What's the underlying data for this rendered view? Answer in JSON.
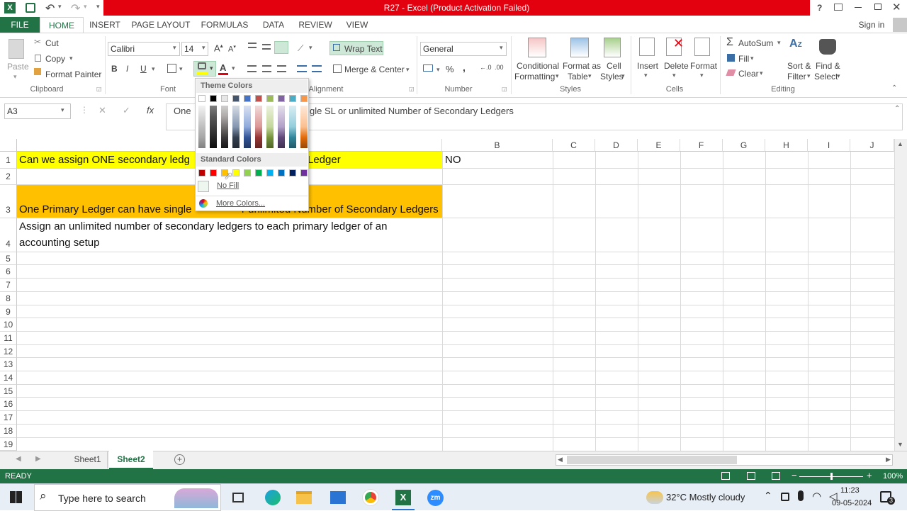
{
  "window": {
    "title": "R27 -  Excel (Product Activation Failed)",
    "help": "?",
    "sign_in": "Sign in"
  },
  "tabs": [
    "FILE",
    "HOME",
    "INSERT",
    "PAGE LAYOUT",
    "FORMULAS",
    "DATA",
    "REVIEW",
    "VIEW"
  ],
  "ribbon": {
    "clipboard": {
      "paste": "Paste",
      "cut": "Cut",
      "copy": "Copy",
      "format_painter": "Format Painter",
      "label": "Clipboard"
    },
    "font": {
      "name": "Calibri",
      "size": "14",
      "bold": "B",
      "italic": "I",
      "underline": "U",
      "label": "Font"
    },
    "alignment": {
      "wrap": "Wrap Text",
      "merge": "Merge & Center",
      "label": "Alignment"
    },
    "number": {
      "format": "General",
      "percent": "%",
      "comma": ",",
      "label": "Number"
    },
    "styles": {
      "conditional": "Conditional",
      "formatting": "Formatting",
      "format_as": "Format as",
      "table": "Table",
      "cell": "Cell",
      "styles": "Styles",
      "label": "Styles"
    },
    "cells": {
      "insert": "Insert",
      "delete": "Delete",
      "format": "Format",
      "label": "Cells"
    },
    "editing": {
      "autosum": "AutoSum",
      "fill": "Fill",
      "clear": "Clear",
      "sort": "Sort &",
      "filter": "Filter",
      "find": "Find &",
      "select": "Select",
      "label": "Editing"
    }
  },
  "formula_bar": {
    "name_box": "A3",
    "fx": "fx",
    "content_left": "One",
    "content_right": "gle SL or unlimited Number of Secondary Ledgers"
  },
  "columns": [
    "B",
    "C",
    "D",
    "E",
    "F",
    "G",
    "H",
    "I",
    "J"
  ],
  "rows": [
    "1",
    "2",
    "3",
    "4",
    "5",
    "6",
    "7",
    "8",
    "9",
    "10",
    "11",
    "12",
    "13",
    "14",
    "15",
    "16",
    "17",
    "18",
    "19"
  ],
  "cells": {
    "a1_left": "Can we assign ONE secondary ledg",
    "a1_right": "Ledger",
    "b1": "NO",
    "a3_left": "One Primary Ledger can have single ",
    "a3_right": "r unlimited Number of Secondary Ledgers",
    "a4_line1": "Assign an unlimited number of secondary ledgers to each primary ledger of an",
    "a4_line2": "accounting setup"
  },
  "color_dropdown": {
    "theme_header": "Theme Colors",
    "standard_header": "Standard Colors",
    "no_fill": "No Fill",
    "more_colors": "More Colors...",
    "theme_top": [
      "#ffffff",
      "#000000",
      "#e7e6e6",
      "#44546a",
      "#4472c4",
      "#c0504d",
      "#9bbb59",
      "#8064a2",
      "#4bacc6",
      "#f79646"
    ],
    "standard": [
      "#c00000",
      "#ff0000",
      "#ffc000",
      "#ffff00",
      "#92d050",
      "#00b050",
      "#00b0f0",
      "#0070c0",
      "#002060",
      "#7030a0"
    ]
  },
  "sheets": [
    "Sheet1",
    "Sheet2"
  ],
  "status": {
    "ready": "READY",
    "zoom": "100%"
  },
  "taskbar": {
    "search_placeholder": "Type here to search",
    "weather": "32°C  Mostly cloudy",
    "time": "11:23",
    "date": "09-05-2024",
    "notification_count": "3"
  },
  "colors": {
    "excel_green": "#217346",
    "title_red": "#e3000f",
    "yellow": "#ffff00",
    "orange": "#ffc000"
  }
}
